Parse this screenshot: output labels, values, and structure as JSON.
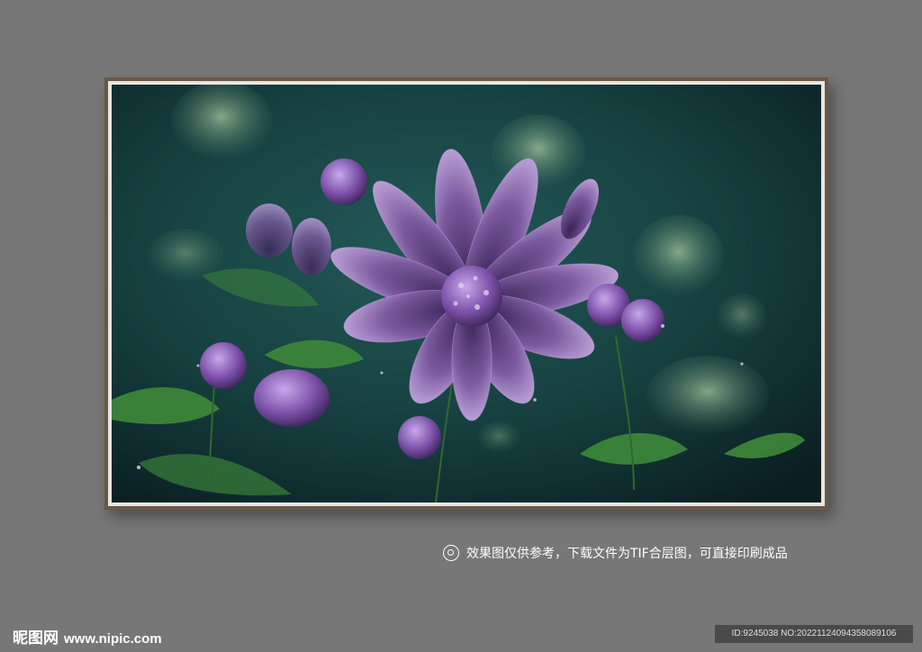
{
  "page": {
    "background": "#777777"
  },
  "frame": {
    "border_color": "#6a5846",
    "mat_color": "#e8e6e2"
  },
  "artwork": {
    "subject": "purple flower with dew drops on dark teal background",
    "palette": {
      "bg_dark": "#0e2a2a",
      "bg_teal": "#1f5252",
      "petal": "#7b5a9e",
      "petal_light": "#b59ad6",
      "leaf": "#3f8a3a"
    }
  },
  "note": {
    "text": "效果图仅供参考，下载文件为TIF合层图，可直接印刷成品",
    "icon": "target-icon"
  },
  "watermark": {
    "brand": "昵图网",
    "url": "www.nipic.com"
  },
  "image_id": {
    "text": "ID:9245038 NO:20221124094358089106"
  }
}
